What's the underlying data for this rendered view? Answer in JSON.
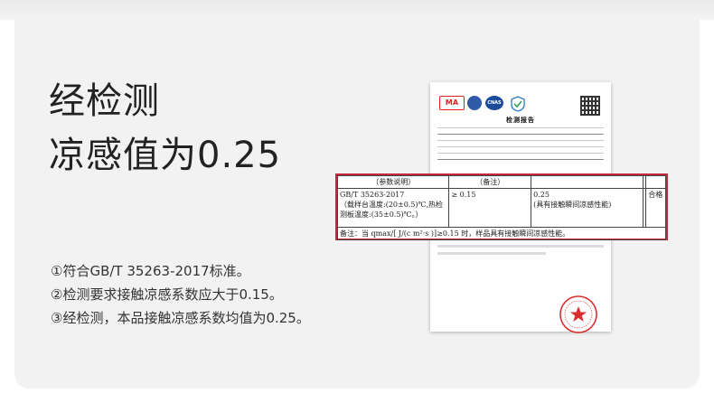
{
  "headline": {
    "line1": "经检测",
    "line2": "凉感值为0.25"
  },
  "notes": [
    "①符合GB/T 35263-2017标准。",
    "②检测要求接触凉感系数应大于0.15。",
    "③经检测，本品接触凉感系数均值为0.25。"
  ],
  "report": {
    "title": "检测报告",
    "logo_ma": "MA",
    "logo_cnas": "CNAS",
    "icons": [
      "cma-logo",
      "ilac-mra-logo",
      "cnas-logo",
      "certification-logo",
      "qr-code",
      "inspection-stamp"
    ]
  },
  "zoom_table": {
    "headers": [
      "（参数说明）",
      "（备注）",
      "",
      "",
      ""
    ],
    "standard": "GB/T 35263-2017",
    "conditions": [
      "（载样台温度:(20±0.5)℃,热检",
      "测板温度:(35±0.5)℃。）"
    ],
    "requirement": "≥ 0.15",
    "result": "0.25",
    "result_note": "(具有接触瞬间凉感性能)",
    "verdict": "合格",
    "remark": "备注：当  qmax/[ J/(c  m²·s )]≥0.15  时，样品具有接触瞬间凉感性能。"
  },
  "colors": {
    "highlight_border": "#c4283a",
    "stamp": "#d9302f"
  }
}
